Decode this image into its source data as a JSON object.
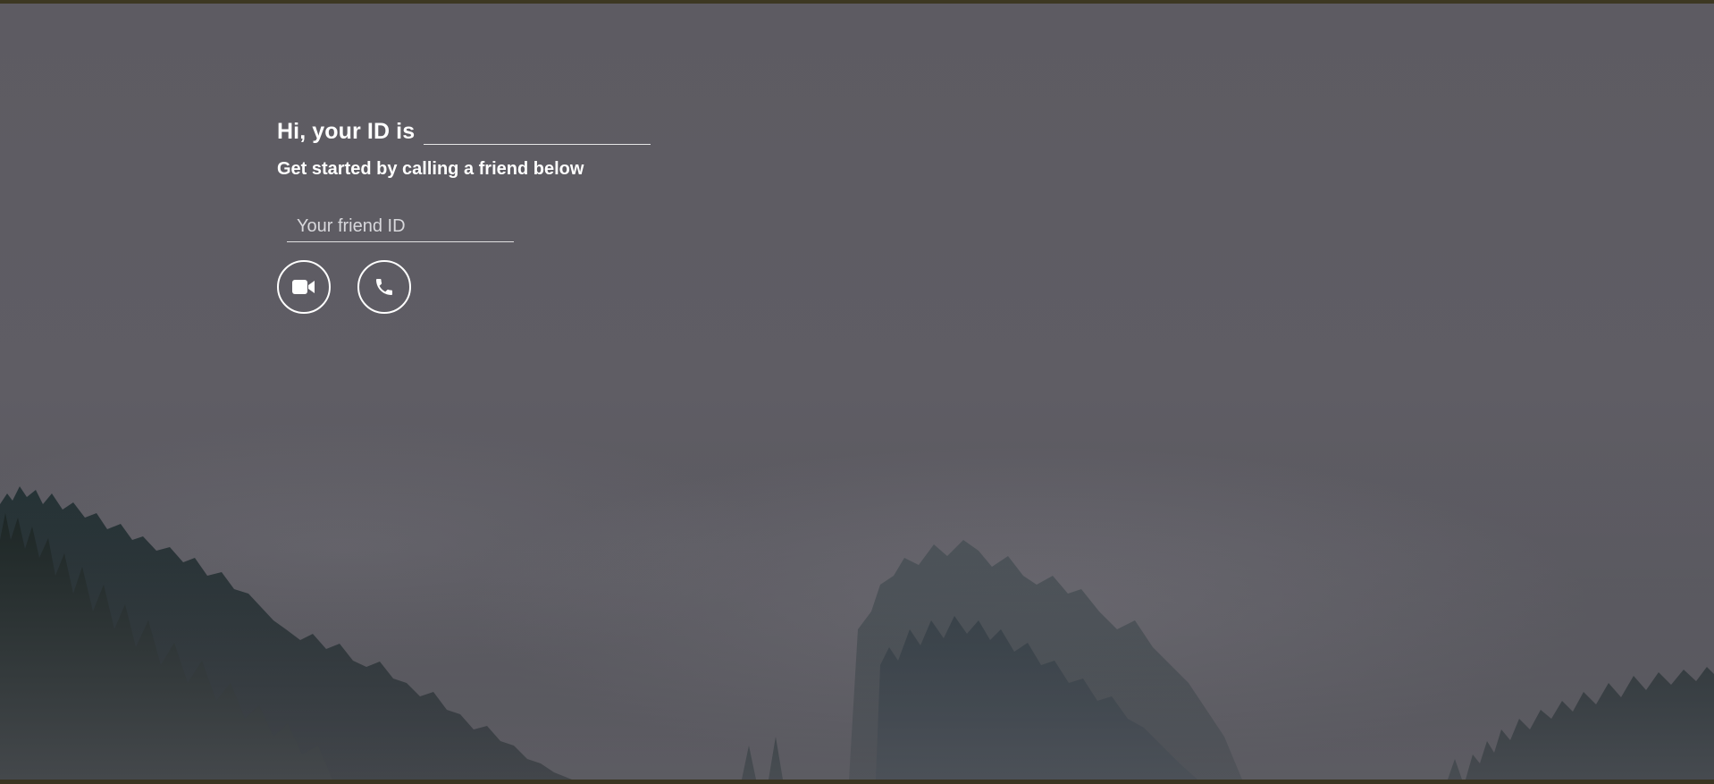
{
  "greeting": {
    "text": "Hi, your ID is",
    "my_id": ""
  },
  "subtitle": "Get started by calling a friend below",
  "friend_input": {
    "placeholder": "Your friend ID",
    "value": ""
  },
  "buttons": {
    "video_call_icon": "video-camera-icon",
    "voice_call_icon": "phone-icon"
  },
  "colors": {
    "text": "#ffffff",
    "background": "#5e5c63",
    "forest": "#1c2a2c"
  }
}
